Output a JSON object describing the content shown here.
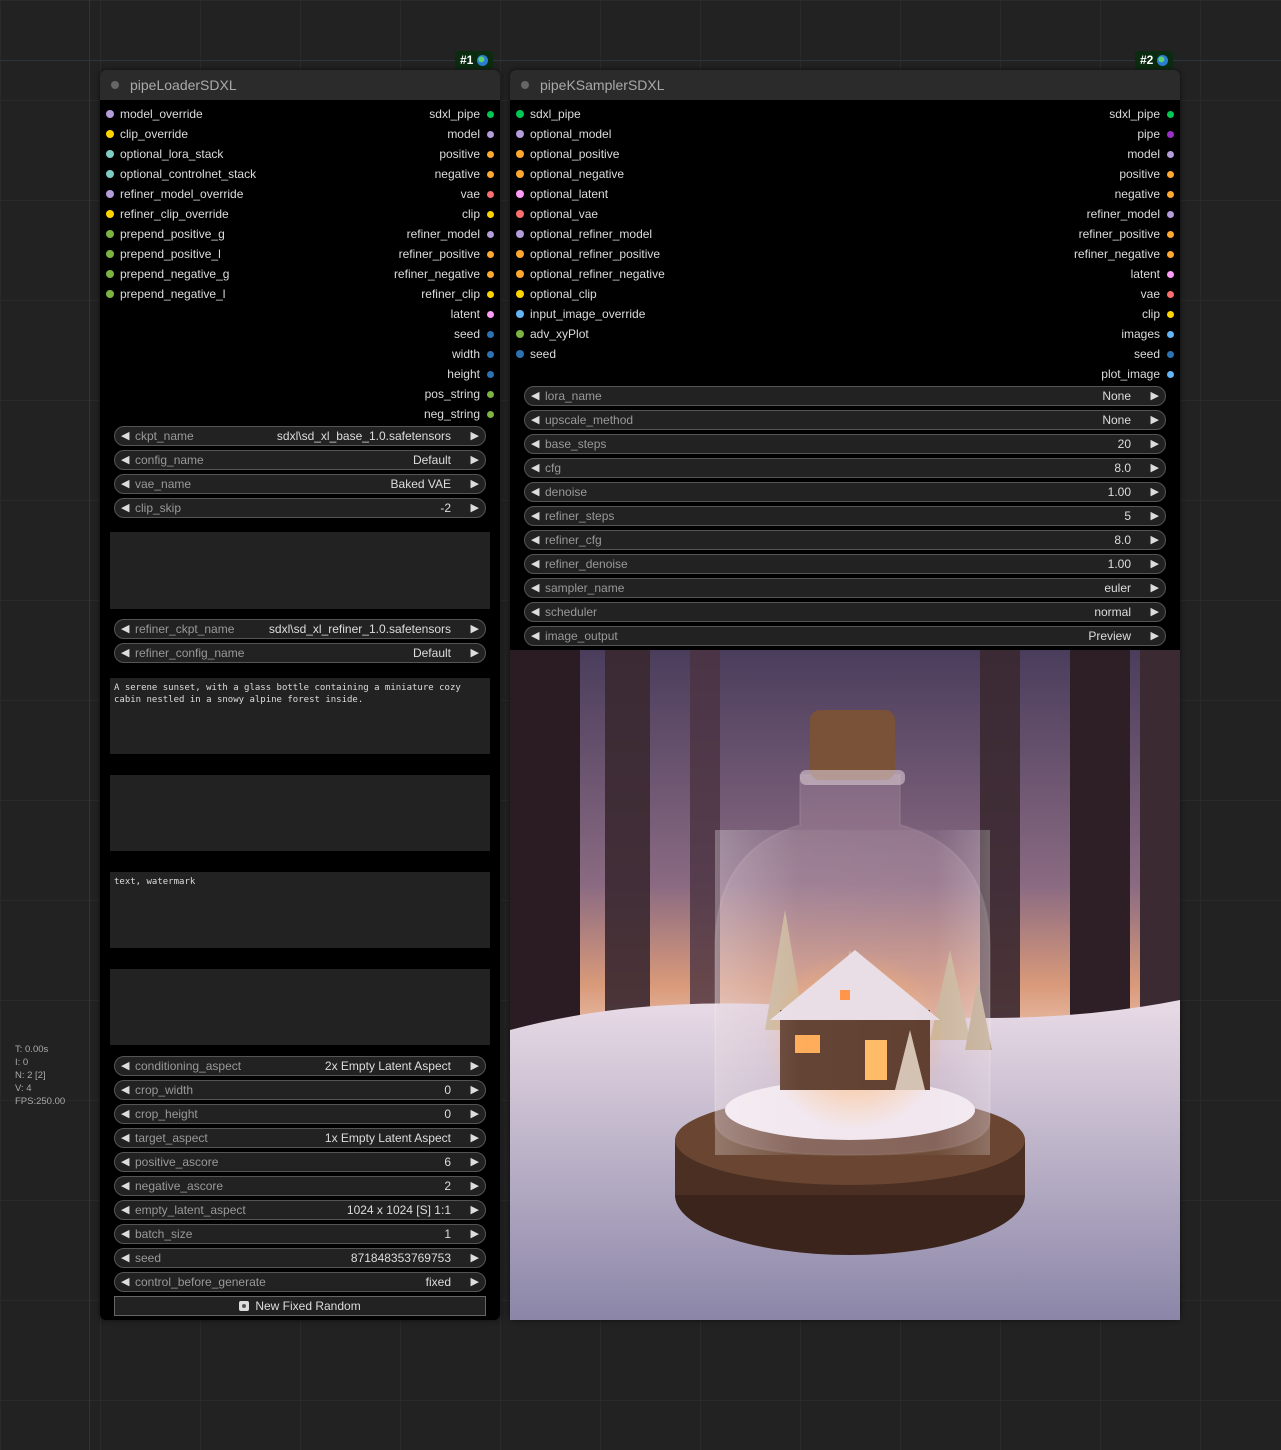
{
  "stats": [
    "T: 0.00s",
    "I: 0",
    "N: 2 [2]",
    "V: 4",
    "FPS:250.00"
  ],
  "node1": {
    "badge": "#1",
    "title": "pipeLoaderSDXL",
    "inputs": [
      {
        "label": "model_override",
        "color": "#b39ddb"
      },
      {
        "label": "clip_override",
        "color": "#ffd500"
      },
      {
        "label": "optional_lora_stack",
        "color": "#80cbc4"
      },
      {
        "label": "optional_controlnet_stack",
        "color": "#80cbc4"
      },
      {
        "label": "refiner_model_override",
        "color": "#b39ddb"
      },
      {
        "label": "refiner_clip_override",
        "color": "#ffd500"
      },
      {
        "label": "prepend_positive_g",
        "color": "#7cb342"
      },
      {
        "label": "prepend_positive_l",
        "color": "#7cb342"
      },
      {
        "label": "prepend_negative_g",
        "color": "#7cb342"
      },
      {
        "label": "prepend_negative_l",
        "color": "#7cb342"
      }
    ],
    "outputs": [
      {
        "label": "sdxl_pipe",
        "color": "#00c853"
      },
      {
        "label": "model",
        "color": "#b39ddb"
      },
      {
        "label": "positive",
        "color": "#ffa931"
      },
      {
        "label": "negative",
        "color": "#ffa931"
      },
      {
        "label": "vae",
        "color": "#ff6e6e"
      },
      {
        "label": "clip",
        "color": "#ffd500"
      },
      {
        "label": "refiner_model",
        "color": "#b39ddb"
      },
      {
        "label": "refiner_positive",
        "color": "#ffa931"
      },
      {
        "label": "refiner_negative",
        "color": "#ffa931"
      },
      {
        "label": "refiner_clip",
        "color": "#ffd500"
      },
      {
        "label": "latent",
        "color": "#ff9cf9"
      },
      {
        "label": "seed",
        "color": "#2c73b4"
      },
      {
        "label": "width",
        "color": "#2c73b4"
      },
      {
        "label": "height",
        "color": "#2c73b4"
      },
      {
        "label": "pos_string",
        "color": "#7cb342"
      },
      {
        "label": "neg_string",
        "color": "#7cb342"
      }
    ],
    "widgets_a": [
      {
        "label": "ckpt_name",
        "value": "sdxl\\sd_xl_base_1.0.safetensors"
      },
      {
        "label": "config_name",
        "value": "Default"
      },
      {
        "label": "vae_name",
        "value": "Baked VAE"
      },
      {
        "label": "clip_skip",
        "value": "-2"
      }
    ],
    "widgets_b": [
      {
        "label": "refiner_ckpt_name",
        "value": "sdxl\\sd_xl_refiner_1.0.safetensors"
      },
      {
        "label": "refiner_config_name",
        "value": "Default"
      }
    ],
    "positive_text": "A serene sunset, with a glass bottle containing a miniature cozy\ncabin nestled in a snowy alpine forest inside.",
    "empty_text_1": "",
    "negative_text": "text, watermark",
    "empty_text_2": "",
    "widgets_c": [
      {
        "label": "conditioning_aspect",
        "value": "2x Empty Latent Aspect"
      },
      {
        "label": "crop_width",
        "value": "0"
      },
      {
        "label": "crop_height",
        "value": "0"
      },
      {
        "label": "target_aspect",
        "value": "1x Empty Latent Aspect"
      },
      {
        "label": "positive_ascore",
        "value": "6"
      },
      {
        "label": "negative_ascore",
        "value": "2"
      },
      {
        "label": "empty_latent_aspect",
        "value": "1024 x 1024 [S] 1:1"
      },
      {
        "label": "batch_size",
        "value": "1"
      },
      {
        "label": "seed",
        "value": "871848353769753"
      },
      {
        "label": "control_before_generate",
        "value": "fixed"
      }
    ],
    "button_label": "New Fixed Random"
  },
  "node2": {
    "badge": "#2",
    "title": "pipeKSamplerSDXL",
    "inputs": [
      {
        "label": "sdxl_pipe",
        "color": "#00c853"
      },
      {
        "label": "optional_model",
        "color": "#b39ddb"
      },
      {
        "label": "optional_positive",
        "color": "#ffa931"
      },
      {
        "label": "optional_negative",
        "color": "#ffa931"
      },
      {
        "label": "optional_latent",
        "color": "#ff9cf9"
      },
      {
        "label": "optional_vae",
        "color": "#ff6e6e"
      },
      {
        "label": "optional_refiner_model",
        "color": "#b39ddb"
      },
      {
        "label": "optional_refiner_positive",
        "color": "#ffa931"
      },
      {
        "label": "optional_refiner_negative",
        "color": "#ffa931"
      },
      {
        "label": "optional_clip",
        "color": "#ffd500"
      },
      {
        "label": "input_image_override",
        "color": "#64b5f6"
      },
      {
        "label": "adv_xyPlot",
        "color": "#7cb342"
      },
      {
        "label": "seed",
        "color": "#2c73b4"
      }
    ],
    "outputs": [
      {
        "label": "sdxl_pipe",
        "color": "#00c853"
      },
      {
        "label": "pipe",
        "color": "#9b30c9"
      },
      {
        "label": "model",
        "color": "#b39ddb"
      },
      {
        "label": "positive",
        "color": "#ffa931"
      },
      {
        "label": "negative",
        "color": "#ffa931"
      },
      {
        "label": "refiner_model",
        "color": "#b39ddb"
      },
      {
        "label": "refiner_positive",
        "color": "#ffa931"
      },
      {
        "label": "refiner_negative",
        "color": "#ffa931"
      },
      {
        "label": "latent",
        "color": "#ff9cf9"
      },
      {
        "label": "vae",
        "color": "#ff6e6e"
      },
      {
        "label": "clip",
        "color": "#ffd500"
      },
      {
        "label": "images",
        "color": "#64b5f6"
      },
      {
        "label": "seed",
        "color": "#2c73b4"
      },
      {
        "label": "plot_image",
        "color": "#64b5f6"
      }
    ],
    "widgets": [
      {
        "label": "lora_name",
        "value": "None"
      },
      {
        "label": "upscale_method",
        "value": "None"
      },
      {
        "label": "base_steps",
        "value": "20"
      },
      {
        "label": "cfg",
        "value": "8.0"
      },
      {
        "label": "denoise",
        "value": "1.00"
      },
      {
        "label": "refiner_steps",
        "value": "5"
      },
      {
        "label": "refiner_cfg",
        "value": "8.0"
      },
      {
        "label": "refiner_denoise",
        "value": "1.00"
      },
      {
        "label": "sampler_name",
        "value": "euler"
      },
      {
        "label": "scheduler",
        "value": "normal"
      },
      {
        "label": "image_output",
        "value": "Preview"
      }
    ]
  }
}
